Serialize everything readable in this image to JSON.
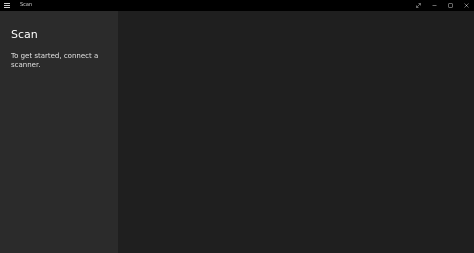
{
  "window": {
    "title": "Scan"
  },
  "sidebar": {
    "heading": "Scan",
    "message": "To get started, connect a scanner."
  },
  "icons": {
    "menu": "hamburger-menu-icon",
    "fullscreen": "fullscreen-icon",
    "minimize": "minimize-icon",
    "maximize": "maximize-icon",
    "close": "close-icon"
  },
  "colors": {
    "titlebar": "#000000",
    "sidebar": "#2b2b2b",
    "main": "#1f1f1f",
    "text": "#ffffff"
  }
}
